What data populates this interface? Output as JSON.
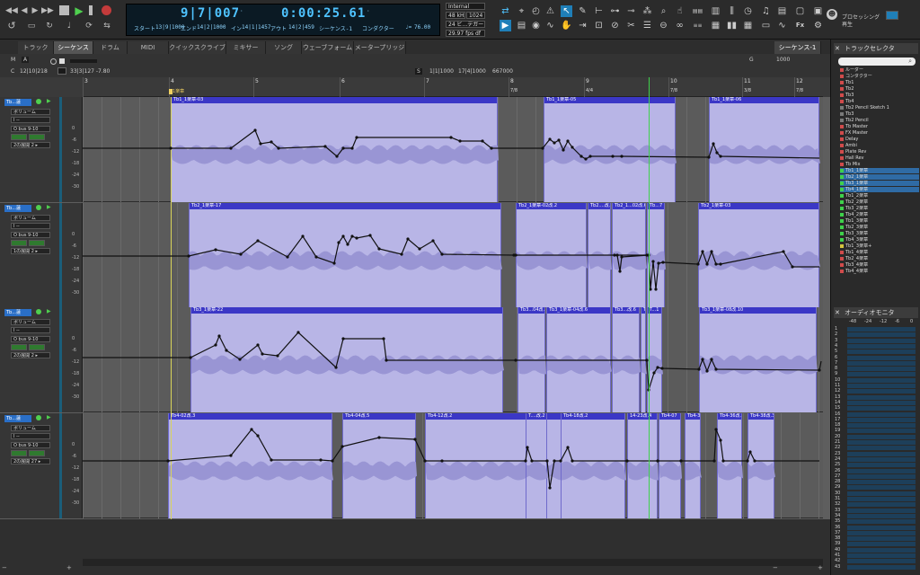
{
  "transport": {
    "counter_main": "9|7|007",
    "counter_main_suffix": "·",
    "counter_sub": "0:00:25.61",
    "counter_sub_suffix": "·",
    "start_label": "スタート",
    "start_value": "13|9|1000",
    "end_label": "エンド",
    "end_value": "14|2|1000",
    "in_label": "イン",
    "in_value": "14|1|1457",
    "out_label": "アウト",
    "out_value": "14|2|459",
    "sequence_label": "シーケンス-1",
    "conductor_label": "コンダクター",
    "tempo": "76.00",
    "sync_source": "Internal",
    "sample_rate": "48 kHz",
    "buffer": "1024",
    "bit_depth": "24 ビ...デガー",
    "frame_rate": "29.97 fps df",
    "processing_label": "プロセッシング",
    "processing_sub": "再生"
  },
  "tabs": [
    "トラック",
    "シーケンス",
    "ドラム",
    "MIDI",
    "クイックスクライブ",
    "ミキサー",
    "ソング",
    "ウェーブフォーム",
    "メータープリッジ"
  ],
  "active_tab": 1,
  "sequence_selector": "シーケンス-1",
  "info": {
    "mode_m": "M",
    "mode_a": "A",
    "counter_c_label": "C",
    "counter_c_value": "12|10|218",
    "counter_s_value": "33|3|127 -7.80",
    "snap_label": "S",
    "snap_value": "1|1|1000",
    "snap_value2": "17|4|1000",
    "snap_value3": "667000",
    "g_label": "G",
    "g_value": "1000"
  },
  "ruler": {
    "bars": [
      "3",
      "4",
      "5",
      "6",
      "7",
      "8",
      "9",
      "10",
      "11",
      "12",
      "13"
    ],
    "sigs": [
      "7/8",
      "4/4",
      "7/8",
      "3/8",
      "7/8",
      "3/8",
      "4/4"
    ],
    "marker": "1楽章"
  },
  "tracks": [
    {
      "name": "Tb...蓮",
      "volume": "ボリューム",
      "insert": "I --",
      "input": "O bus 9-10",
      "group": "2の展開 2 ▸",
      "scale": [
        "0",
        "-6",
        "-12",
        "-18",
        "-24",
        "-30"
      ],
      "clips": [
        "Tb1_1楽章-03",
        "Tb1_1楽章-05",
        "Tb1_1楽章-06"
      ]
    },
    {
      "name": "Tb...蓮",
      "volume": "ボリューム",
      "insert": "I --",
      "input": "O bus 9-10",
      "group": "1の展開 2 ▸",
      "scale": [
        "0",
        "-6",
        "-12",
        "-18",
        "-24",
        "-30"
      ],
      "clips": [
        "Tb2_1楽章-17",
        "Tb2_1楽章-02改.2",
        "Tb2....改.4",
        "Tb2_1...02改.6",
        "Tb...7",
        "Tb2_1楽章-03"
      ]
    },
    {
      "name": "Tb...蓮",
      "volume": "ボリューム",
      "insert": "I --",
      "input": "O bus 9-10",
      "group": "2の展開 2 ▸",
      "scale": [
        "0",
        "-6",
        "-12",
        "-18",
        "-24",
        "-30"
      ],
      "clips": [
        "Tb3_1楽章-22",
        "Tb3...04改.4",
        "Tb3_1楽章-04改.6",
        "Tb3...改.6",
        "Tb3_1楽章-04",
        "T...1",
        "Tb3_1楽章-08改.10"
      ]
    },
    {
      "name": "Tb...蓮",
      "volume": "ボリューム",
      "insert": "I --",
      "input": "O bus 9-10",
      "group": "2の展開 27 ▸",
      "scale": [
        "0",
        "-6",
        "-12",
        "-18",
        "-24",
        "-30"
      ],
      "clips": [
        "Tb4-02改.3",
        "Tb4-04改.5",
        "Tb4-12改.2",
        "T....改.2",
        "Tb4-18改.2",
        "14-23改.4",
        "Tb4-07",
        "Tb4-37",
        "Tb4-36改.3",
        "Tb4-38改.3"
      ]
    }
  ],
  "track_selector": {
    "title": "トラックセレクタ",
    "items": [
      {
        "label": "ルーダー",
        "color": "#d04b4b",
        "sel": false
      },
      {
        "label": "コンダクター",
        "color": "#d04b4b",
        "sel": false
      },
      {
        "label": "Tb1",
        "color": "#d04b4b",
        "sel": false
      },
      {
        "label": "Tb2",
        "color": "#d04b4b",
        "sel": false
      },
      {
        "label": "Tb3",
        "color": "#d04b4b",
        "sel": false
      },
      {
        "label": "Tb4",
        "color": "#d04b4b",
        "sel": false
      },
      {
        "label": "Tb2 Pencil Sketch 1",
        "color": "#7a7a7a",
        "sel": false
      },
      {
        "label": "Tb3",
        "color": "#7a7a7a",
        "sel": false
      },
      {
        "label": "Tb2 Pencil",
        "color": "#7a7a7a",
        "sel": false
      },
      {
        "label": "Tb Master",
        "color": "#d04b4b",
        "sel": false
      },
      {
        "label": "FX Master",
        "color": "#d04b4b",
        "sel": false
      },
      {
        "label": "Delay",
        "color": "#d04b4b",
        "sel": false
      },
      {
        "label": "Ambi",
        "color": "#d04b4b",
        "sel": false
      },
      {
        "label": "Plate Rev",
        "color": "#d04b4b",
        "sel": false
      },
      {
        "label": "Hall Rev",
        "color": "#d04b4b",
        "sel": false
      },
      {
        "label": "Tb Mix",
        "color": "#d04b4b",
        "sel": false
      },
      {
        "label": "Tb1_1楽章",
        "color": "#3fd14b",
        "sel": true
      },
      {
        "label": "Tb2_1楽章",
        "color": "#3fd14b",
        "sel": true
      },
      {
        "label": "Tb3_1楽章",
        "color": "#3fd14b",
        "sel": true
      },
      {
        "label": "Tb4_1楽章",
        "color": "#3fd14b",
        "sel": true
      },
      {
        "label": "Tb1_2楽章",
        "color": "#3fd14b",
        "sel": false
      },
      {
        "label": "Tb2_2楽章",
        "color": "#3fd14b",
        "sel": false
      },
      {
        "label": "Tb3_2楽章",
        "color": "#3fd14b",
        "sel": false
      },
      {
        "label": "Tb4_2楽章",
        "color": "#3fd14b",
        "sel": false
      },
      {
        "label": "Tb1_3楽章",
        "color": "#3fd14b",
        "sel": false
      },
      {
        "label": "Tb2_3楽章",
        "color": "#3fd14b",
        "sel": false
      },
      {
        "label": "Tb3_3楽章",
        "color": "#3fd14b",
        "sel": false
      },
      {
        "label": "Tb4_3楽章",
        "color": "#3fd14b",
        "sel": false
      },
      {
        "label": "Tb1_3楽章+",
        "color": "#d4c43f",
        "sel": false
      },
      {
        "label": "Tb1_4楽章",
        "color": "#d04b4b",
        "sel": false
      },
      {
        "label": "Tb2_4楽章",
        "color": "#d04b4b",
        "sel": false
      },
      {
        "label": "Tb3_4楽章",
        "color": "#d04b4b",
        "sel": false
      },
      {
        "label": "Tb4_4楽章",
        "color": "#d04b4b",
        "sel": false
      }
    ]
  },
  "audio_monitor": {
    "title": "オーディオモニタ",
    "scale": [
      "-48",
      "-24",
      "-12",
      "-6",
      "0"
    ],
    "rows": [
      "1",
      "2",
      "3",
      "4",
      "5",
      "6",
      "7",
      "8",
      "9",
      "10",
      "11",
      "12",
      "13",
      "14",
      "15",
      "16",
      "17",
      "18",
      "19",
      "20",
      "21",
      "22",
      "23",
      "24",
      "25",
      "26",
      "27",
      "28",
      "29",
      "30",
      "31",
      "32",
      "33",
      "34",
      "35",
      "36",
      "37",
      "38",
      "39",
      "40",
      "41",
      "42",
      "43"
    ]
  },
  "colors": {
    "clip_fill": "#b8b5e6",
    "clip_header": "#3b37c6",
    "automation_line": "#111111",
    "selected_track": "#2f6ba5",
    "green_cursor": "#3fd14b",
    "yellow_cursor": "#d9d45a",
    "lcd_text": "#4fc3ff"
  }
}
